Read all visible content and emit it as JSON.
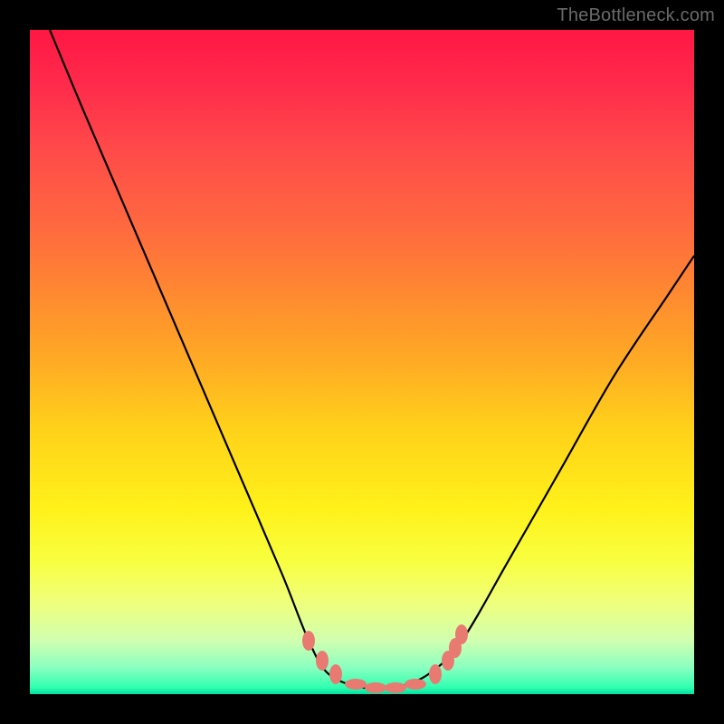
{
  "watermark": "TheBottleneck.com",
  "chart_data": {
    "type": "line",
    "title": "",
    "xlabel": "",
    "ylabel": "",
    "xlim": [
      0,
      100
    ],
    "ylim": [
      0,
      100
    ],
    "grid": false,
    "legend": false,
    "series": [
      {
        "name": "bottleneck-curve",
        "color": "#000000",
        "points": [
          {
            "x": 3,
            "y": 100
          },
          {
            "x": 8,
            "y": 88
          },
          {
            "x": 14,
            "y": 74
          },
          {
            "x": 20,
            "y": 60
          },
          {
            "x": 26,
            "y": 46
          },
          {
            "x": 32,
            "y": 32
          },
          {
            "x": 38,
            "y": 18
          },
          {
            "x": 42,
            "y": 8
          },
          {
            "x": 45,
            "y": 3
          },
          {
            "x": 50,
            "y": 1
          },
          {
            "x": 55,
            "y": 1
          },
          {
            "x": 60,
            "y": 3
          },
          {
            "x": 65,
            "y": 8
          },
          {
            "x": 72,
            "y": 20
          },
          {
            "x": 80,
            "y": 34
          },
          {
            "x": 88,
            "y": 48
          },
          {
            "x": 96,
            "y": 60
          },
          {
            "x": 100,
            "y": 66
          }
        ]
      }
    ],
    "markers": {
      "name": "highlight-dots",
      "color": "#e87a72",
      "points": [
        {
          "x": 42,
          "y": 8
        },
        {
          "x": 44,
          "y": 5
        },
        {
          "x": 46,
          "y": 3
        },
        {
          "x": 49,
          "y": 1.5
        },
        {
          "x": 52,
          "y": 1
        },
        {
          "x": 55,
          "y": 1
        },
        {
          "x": 58,
          "y": 1.5
        },
        {
          "x": 61,
          "y": 3
        },
        {
          "x": 63,
          "y": 5
        },
        {
          "x": 64,
          "y": 7
        },
        {
          "x": 65,
          "y": 9
        }
      ]
    },
    "background": "rainbow-vertical-gradient"
  }
}
